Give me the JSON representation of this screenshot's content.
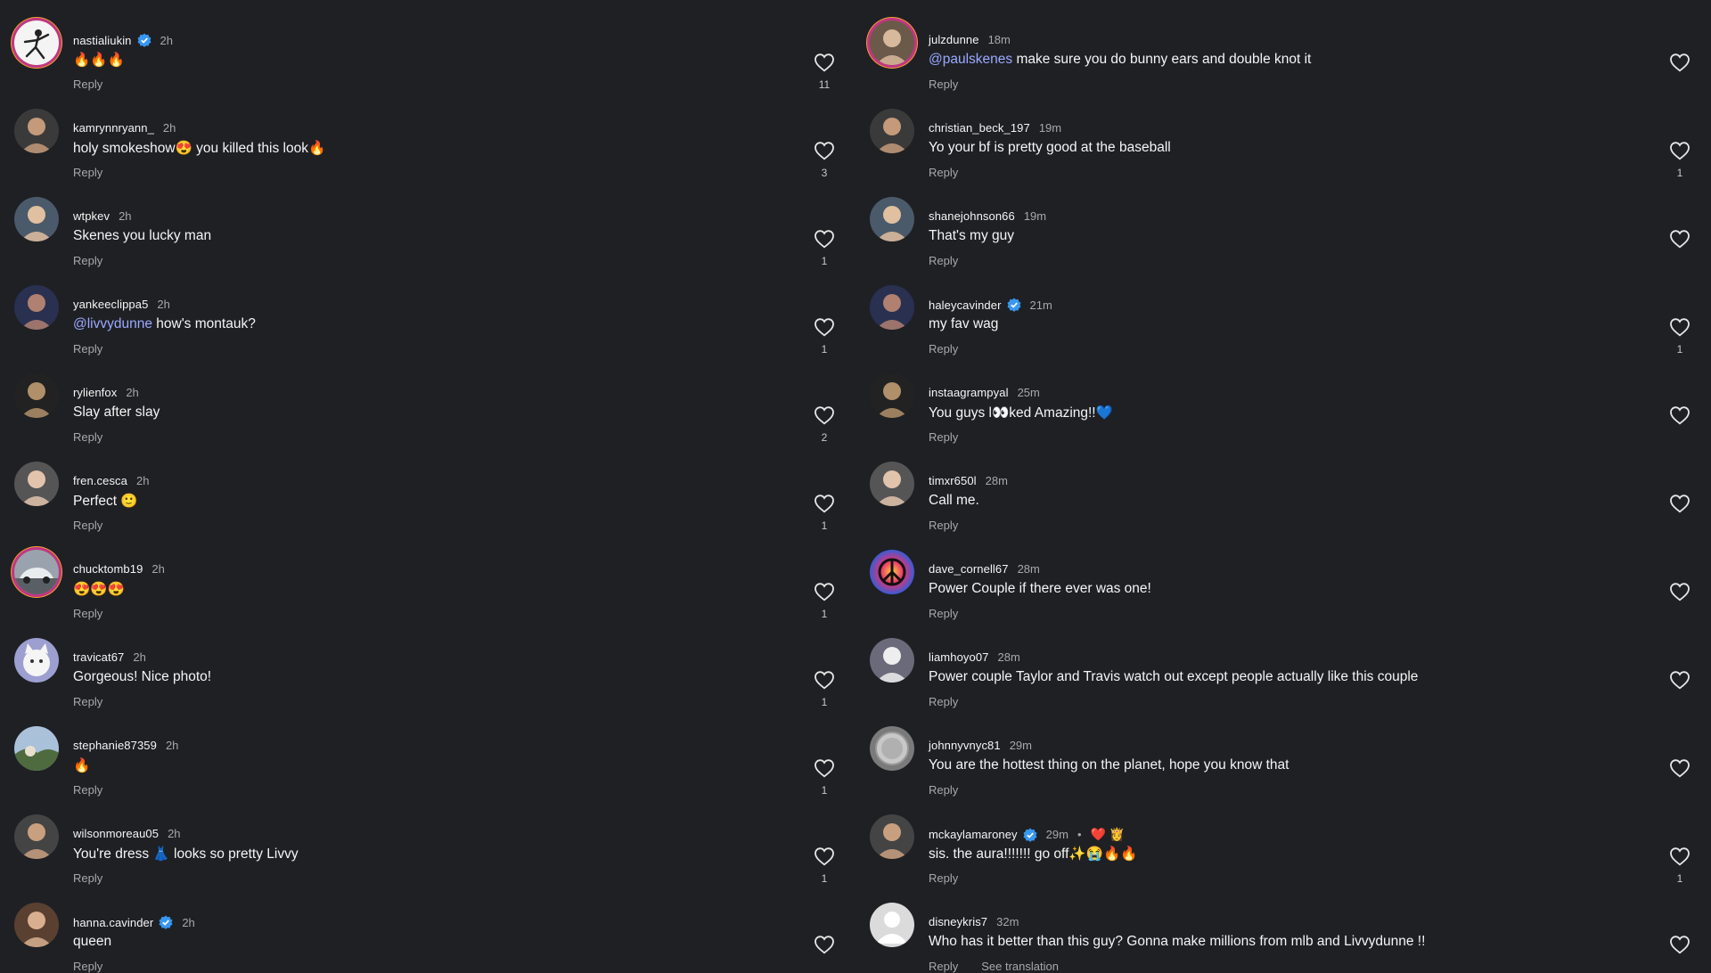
{
  "colors": {
    "background": "#1f2024",
    "mention": "#9aa9ff",
    "muted": "#a8a8a8",
    "verified": "#3897f0"
  },
  "reply_label": "Reply",
  "left": [
    {
      "user": "nastialiukin",
      "verified": true,
      "time": "2h",
      "text": "🔥🔥🔥",
      "likes": "11",
      "ring": true,
      "avatar": "dancer-avatar"
    },
    {
      "user": "kamrynnryann_",
      "verified": false,
      "time": "2h",
      "text": "holy smokeshow😍 you killed this look🔥",
      "likes": "3",
      "avatar": "portrait-avatar"
    },
    {
      "user": "wtpkev",
      "verified": false,
      "time": "2h",
      "text": "Skenes you lucky man",
      "likes": "1",
      "avatar": "portrait-avatar"
    },
    {
      "user": "yankeeclippa5",
      "verified": false,
      "time": "2h",
      "mention": "@livvydunne",
      "text": " how's montauk?",
      "likes": "1",
      "avatar": "portrait-avatar"
    },
    {
      "user": "rylienfox",
      "verified": false,
      "time": "2h",
      "text": "Slay after slay",
      "likes": "2",
      "avatar": "portrait-avatar"
    },
    {
      "user": "fren.cesca",
      "verified": false,
      "time": "2h",
      "text": "Perfect 🙂",
      "likes": "1",
      "avatar": "portrait-avatar"
    },
    {
      "user": "chucktomb19",
      "verified": false,
      "time": "2h",
      "text": "😍😍😍",
      "likes": "1",
      "ring": true,
      "avatar": "car-avatar"
    },
    {
      "user": "travicat67",
      "verified": false,
      "time": "2h",
      "text": "Gorgeous!  Nice photo!",
      "likes": "1",
      "avatar": "cat-avatar"
    },
    {
      "user": "stephanie87359",
      "verified": false,
      "time": "2h",
      "text": "🔥",
      "likes": "1",
      "avatar": "landscape-avatar"
    },
    {
      "user": "wilsonmoreau05",
      "verified": false,
      "time": "2h",
      "text": "You're dress 👗 looks so pretty Livvy",
      "likes": "1",
      "avatar": "portrait-avatar"
    },
    {
      "user": "hanna.cavinder",
      "verified": true,
      "time": "2h",
      "text": "queen",
      "likes": "",
      "avatar": "portrait-avatar"
    }
  ],
  "right": [
    {
      "user": "julzdunne",
      "verified": false,
      "time": "18m",
      "mention": "@paulskenes",
      "text": " make sure you do bunny ears and double knot it",
      "likes": "",
      "ring": true,
      "avatar": "portrait-avatar"
    },
    {
      "user": "christian_beck_197",
      "verified": false,
      "time": "19m",
      "text": "Yo your bf is pretty good at the baseball",
      "likes": "1",
      "avatar": "portrait-avatar"
    },
    {
      "user": "shanejohnson66",
      "verified": false,
      "time": "19m",
      "text": "That's my guy",
      "likes": "",
      "avatar": "portrait-avatar"
    },
    {
      "user": "haleycavinder",
      "verified": true,
      "time": "21m",
      "text": "my fav wag",
      "likes": "1",
      "avatar": "portrait-avatar"
    },
    {
      "user": "instaagrampyal",
      "verified": false,
      "time": "25m",
      "text": "You guys l👀ked Amazing!!💙",
      "likes": "",
      "avatar": "portrait-avatar"
    },
    {
      "user": "timxr650l",
      "verified": false,
      "time": "28m",
      "text": "Call me.",
      "likes": "",
      "avatar": "portrait-avatar"
    },
    {
      "user": "dave_cornell67",
      "verified": false,
      "time": "28m",
      "text": "Power Couple if there ever was one!",
      "likes": "",
      "avatar": "peace-avatar"
    },
    {
      "user": "liamhoyo07",
      "verified": false,
      "time": "28m",
      "text": "Power couple Taylor and Travis watch out except people actually like this couple",
      "likes": "",
      "avatar": "portrait-avatar"
    },
    {
      "user": "johnnyvnyc81",
      "verified": false,
      "time": "29m",
      "text": "You are the hottest thing on the planet, hope you know that",
      "likes": "",
      "avatar": "coin-avatar"
    },
    {
      "user": "mckaylamaroney",
      "verified": true,
      "time": "29m",
      "dot": "•",
      "extra": "❤️ 👸",
      "text": "sis. the aura!!!!!!! go off✨😭🔥🔥",
      "likes": "1",
      "avatar": "portrait-avatar"
    },
    {
      "user": "disneykris7",
      "verified": false,
      "time": "32m",
      "text": "Who has it better than this guy? Gonna make millions from mlb and Livvydunne !!",
      "likes": "",
      "see_translation": "See translation",
      "avatar": "default-avatar"
    }
  ]
}
